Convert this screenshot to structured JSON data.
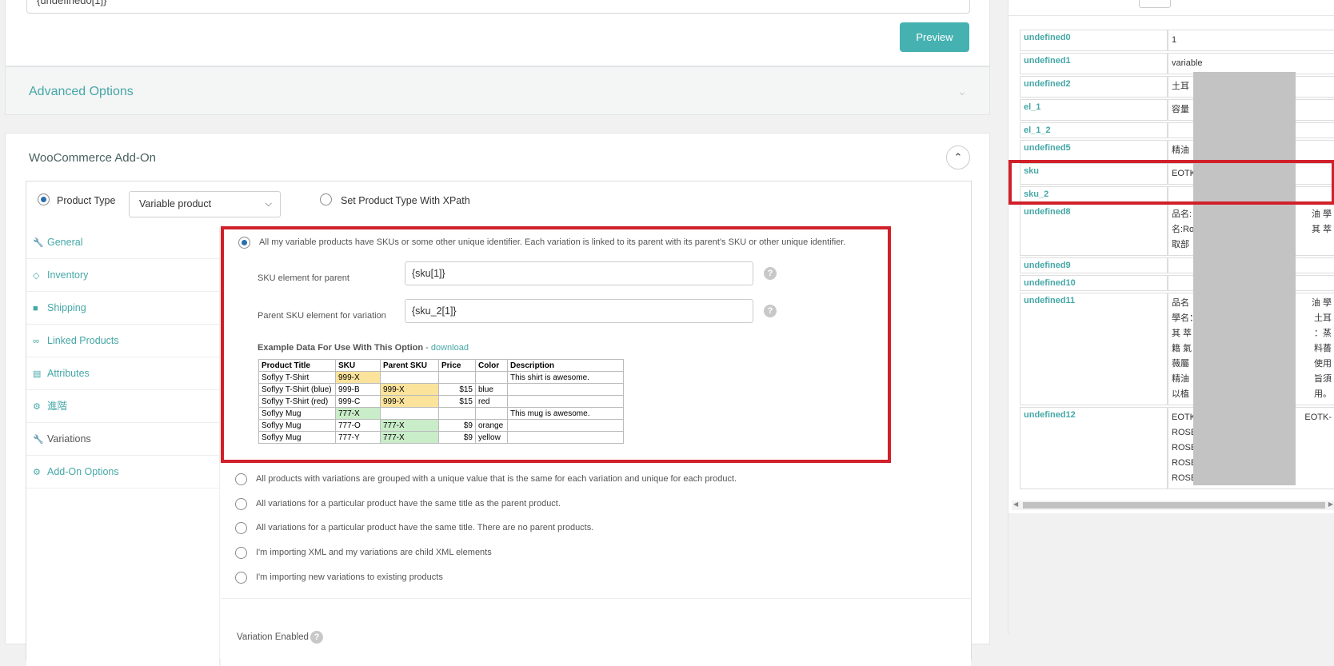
{
  "top": {
    "input_value": "{undefined0[1]}",
    "preview_label": "Preview"
  },
  "advanced": {
    "title": "Advanced Options"
  },
  "woo": {
    "title": "WooCommerce Add-On",
    "product_type_label": "Product Type",
    "product_type_value": "Variable product",
    "xpath_label": "Set Product Type With XPath",
    "tabs": [
      {
        "icon": "wrench-icon",
        "label": "General"
      },
      {
        "icon": "tag-icon",
        "label": "Inventory"
      },
      {
        "icon": "truck-icon",
        "label": "Shipping"
      },
      {
        "icon": "link-icon",
        "label": "Linked Products"
      },
      {
        "icon": "table-icon",
        "label": "Attributes"
      },
      {
        "icon": "gear-icon",
        "label": "進階"
      },
      {
        "icon": "wrench-icon",
        "label": "Variations"
      },
      {
        "icon": "gear-icon",
        "label": "Add-On Options"
      }
    ],
    "option1": "All my variable products have SKUs or some other unique identifier. Each variation is linked to its parent with its parent's SKU or other unique identifier.",
    "sku_parent_label": "SKU element for parent",
    "sku_parent_value": "{sku[1]}",
    "sku_var_label": "Parent SKU element for variation",
    "sku_var_value": "{sku_2[1]}",
    "example_title": "Example Data For Use With This Option",
    "example_sep": " - ",
    "example_link": "download",
    "example_table": {
      "headers": [
        "Product Title",
        "SKU",
        "Parent SKU",
        "Price",
        "Color",
        "Description"
      ],
      "rows": [
        [
          "Soflyy T-Shirt",
          "999-X",
          "",
          "",
          "",
          "This shirt is awesome."
        ],
        [
          "Soflyy T-Shirt (blue)",
          "999-B",
          "999-X",
          "$15",
          "blue",
          ""
        ],
        [
          "Soflyy T-Shirt (red)",
          "999-C",
          "999-X",
          "$15",
          "red",
          ""
        ],
        [
          "Soflyy Mug",
          "777-X",
          "",
          "",
          "",
          "This mug is awesome."
        ],
        [
          "Soflyy Mug",
          "777-O",
          "777-X",
          "$9",
          "orange",
          ""
        ],
        [
          "Soflyy Mug",
          "777-Y",
          "777-X",
          "$9",
          "yellow",
          ""
        ]
      ]
    },
    "options": [
      "All products with variations are grouped with a unique value that is the same for each variation and unique for each product.",
      "All variations for a particular product have the same title as the parent product.",
      "All variations for a particular product have the same title. There are no parent products.",
      "I'm importing XML and my variations are child XML elements",
      "I'm importing new variations to existing products"
    ],
    "variation_enabled_label": "Variation Enabled"
  },
  "right": {
    "rows": [
      {
        "key": "undefined0",
        "value": "1"
      },
      {
        "key": "undefined1",
        "value": "variable"
      },
      {
        "key": "undefined2",
        "value": "土耳"
      },
      {
        "key": "el_1",
        "value": "容量"
      },
      {
        "key": "el_1_2",
        "value": ""
      },
      {
        "key": "undefined5",
        "value": "精油"
      },
      {
        "key": "sku",
        "value": "EOTK"
      },
      {
        "key": "sku_2",
        "value": ""
      },
      {
        "key": "undefined8",
        "lines": [
          "品名:",
          "名:Ro",
          "取部"
        ],
        "right_lines": [
          "油 學",
          "其 萃",
          ""
        ]
      },
      {
        "key": "undefined9",
        "value": ""
      },
      {
        "key": "undefined10",
        "value": ""
      },
      {
        "key": "undefined11",
        "lines": [
          "品名",
          "學名：F",
          "其 萃",
          "籍 氣",
          "薇屬",
          "精油",
          "以植"
        ],
        "right_lines": [
          "油 學",
          "土耳",
          "：蒸",
          "料薔",
          "使用",
          "旨須",
          "用。"
        ]
      },
      {
        "key": "undefined12",
        "lines": [
          "EOTK",
          "ROSE",
          "ROSE",
          "ROSE",
          "ROSE"
        ],
        "right_lines": [
          "EOTK-",
          "",
          "",
          "",
          ""
        ]
      }
    ]
  },
  "colors": {
    "accent": "#46a7a7",
    "button": "#46b1b1",
    "highlight": "#d0202a",
    "yellow": "#fbe39c",
    "green": "#c9ecc9"
  }
}
